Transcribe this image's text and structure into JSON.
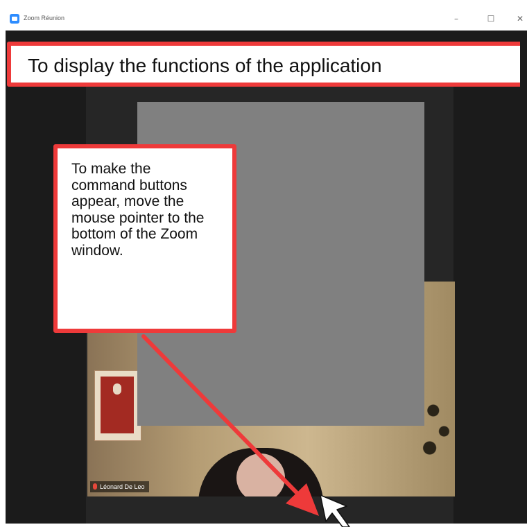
{
  "window": {
    "title": "Zoom Réunion",
    "controls": {
      "minimize_glyph": "–",
      "maximize_glyph": "☐",
      "close_glyph": "✕"
    },
    "icon": "zoom-app-icon"
  },
  "video": {
    "participant_name": "Léonard De Leo"
  },
  "annotations": {
    "banner_text": "To display the functions of the application",
    "callout_text": "To make the command buttons appear, move the mouse pointer to the bottom of the Zoom window.",
    "accent_color": "#ee3a3a",
    "cursor_icon": "mouse-pointer-icon"
  }
}
